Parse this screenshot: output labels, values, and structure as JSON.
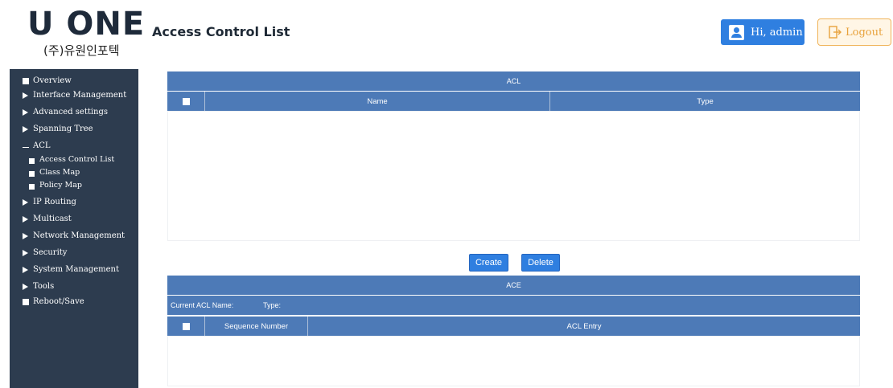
{
  "header": {
    "logo_text": "U ONE",
    "logo_subtext": "(주)유원인포텍",
    "page_title": "Access Control List",
    "user_button_label": "Hi, admin",
    "logout_button_label": "Logout"
  },
  "sidebar": {
    "items": [
      {
        "label": "Overview",
        "marker": "square"
      },
      {
        "label": "Interface Management",
        "marker": "triangle"
      },
      {
        "label": "Advanced settings",
        "marker": "triangle"
      },
      {
        "label": "Spanning Tree",
        "marker": "triangle"
      },
      {
        "label": "ACL",
        "marker": "dash",
        "expanded": true
      },
      {
        "label": "IP Routing",
        "marker": "triangle"
      },
      {
        "label": "Multicast",
        "marker": "triangle"
      },
      {
        "label": "Network Management",
        "marker": "triangle"
      },
      {
        "label": "Security",
        "marker": "triangle"
      },
      {
        "label": "System Management",
        "marker": "triangle"
      },
      {
        "label": "Tools",
        "marker": "triangle"
      },
      {
        "label": "Reboot/Save",
        "marker": "square"
      }
    ],
    "acl_subitems": [
      {
        "label": "Access Control List"
      },
      {
        "label": "Class Map"
      },
      {
        "label": "Policy Map"
      }
    ]
  },
  "acl_panel": {
    "title": "ACL",
    "columns": [
      "Name",
      "Type"
    ],
    "rows": []
  },
  "actions": {
    "create_label": "Create",
    "delete_label": "Delete"
  },
  "ace_panel": {
    "title": "ACE",
    "current_acl_label": "Current ACL Name:",
    "type_label": "Type:",
    "columns": [
      "Sequence Number",
      "ACL Entry"
    ],
    "rows": []
  },
  "colors": {
    "sidebar_bg": "#2d3c4f",
    "table_header": "#4d7ab7",
    "primary_button": "#2f7fe0",
    "logout_accent": "#e8a23c"
  },
  "icons": {
    "user": "user-icon",
    "logout": "logout-icon"
  }
}
